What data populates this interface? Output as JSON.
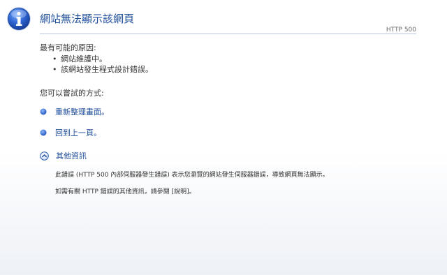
{
  "header": {
    "title": "網站無法顯示該網頁",
    "error_code": "HTTP 500",
    "icon": "info-icon"
  },
  "reasons": {
    "heading": "最有可能的原因:",
    "items": [
      {
        "text": "網站維護中。"
      },
      {
        "text": "該網站發生程式設計錯誤。"
      }
    ]
  },
  "try": {
    "heading": "您可以嘗試的方式:",
    "refresh_label": "重新整理畫面。",
    "back_label": "回到上一頁。",
    "more_info_label": "其他資訊"
  },
  "details": {
    "line1": "此錯誤 (HTTP 500 內部伺服器發生錯誤) 表示您瀏覽的網站發生伺服器錯誤，導致網頁無法顯示。",
    "line2": "如需有關 HTTP 錯誤的其他資訊，請參閱 [說明]。"
  },
  "colors": {
    "title": "#1f4e99",
    "link": "#1f4e99",
    "bullet_blue": "#2b63c4",
    "rule": "#b9c7dd"
  }
}
